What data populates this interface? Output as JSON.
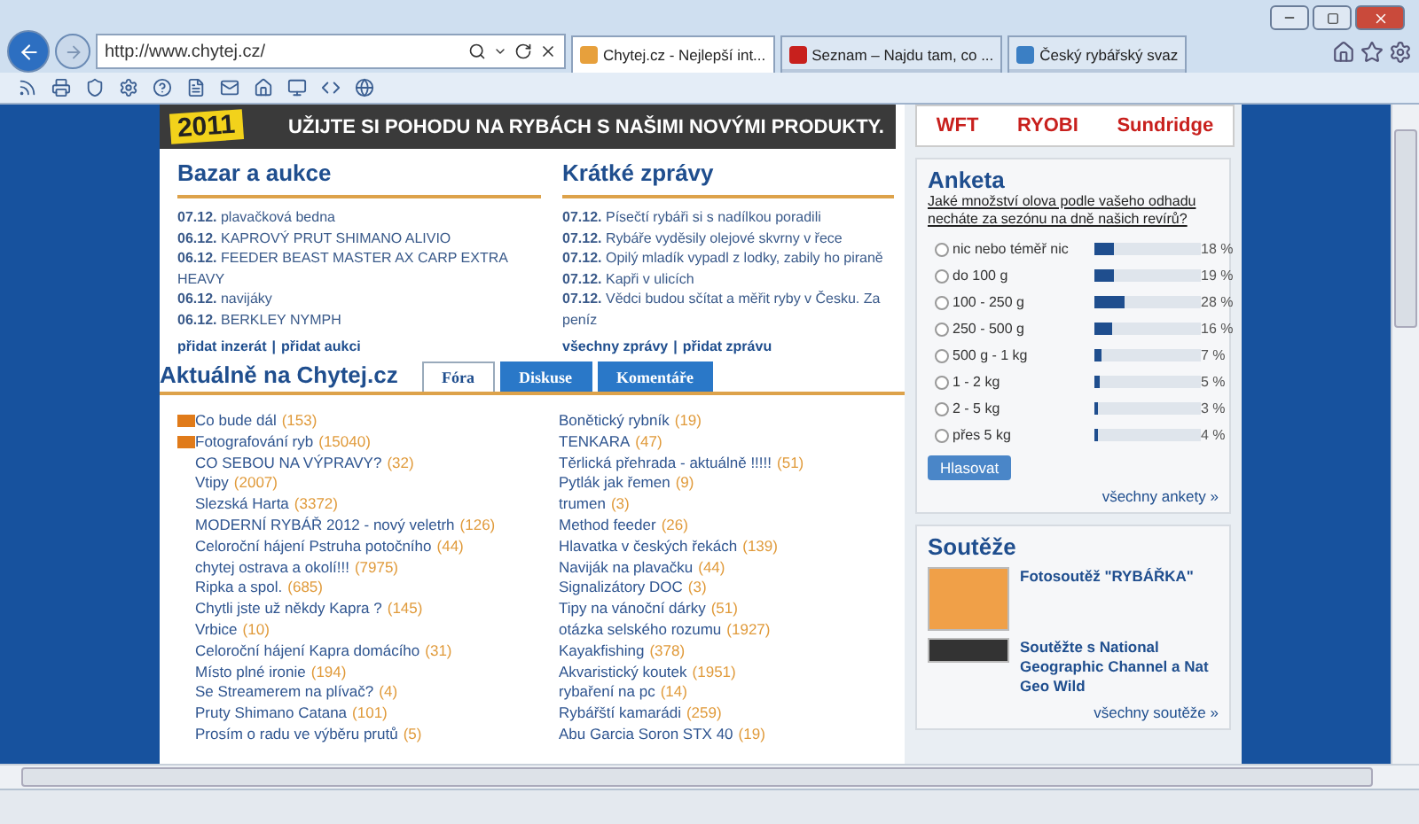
{
  "browser": {
    "address": "http://www.chytej.cz/",
    "tabs": [
      {
        "title": "Chytej.cz - Nejlepší int...",
        "selected": true,
        "kind": "fish"
      },
      {
        "title": "Seznam – Najdu tam, co ...",
        "selected": false,
        "kind": "brand"
      },
      {
        "title": "Český rybářský svaz",
        "selected": false,
        "kind": "globe"
      }
    ]
  },
  "banner": {
    "badge": "2011",
    "slogan": "UŽIJTE SI POHODU NA RYBÁCH S NAŠIMI NOVÝMI PRODUKTY.",
    "sponsors": [
      "WFT",
      "RYOBI",
      "Sundridge"
    ]
  },
  "bazar": {
    "title": "Bazar a aukce",
    "items": [
      {
        "date": "07.12.",
        "text": "plavačková bedna"
      },
      {
        "date": "06.12.",
        "text": "KAPROVÝ PRUT SHIMANO ALIVIO"
      },
      {
        "date": "06.12.",
        "text": "FEEDER BEAST MASTER AX CARP EXTRA HEAVY"
      },
      {
        "date": "06.12.",
        "text": "navijáky"
      },
      {
        "date": "06.12.",
        "text": "BERKLEY NYMPH"
      }
    ],
    "links": [
      "přidat inzerát",
      "přidat aukci"
    ],
    "separator": "|"
  },
  "news": {
    "title": "Krátké zprávy",
    "items": [
      {
        "date": "07.12.",
        "text": "Písečtí rybáři si s nadílkou poradili"
      },
      {
        "date": "07.12.",
        "text": "Rybáře vyděsily olejové skvrny v řece"
      },
      {
        "date": "07.12.",
        "text": "Opilý mladík vypadl z lodky, zabily ho piraně"
      },
      {
        "date": "07.12.",
        "text": "Kapři v ulicích"
      },
      {
        "date": "07.12.",
        "text": "Vědci budou sčítat a měřit ryby v Česku. Za peníz"
      }
    ],
    "links": [
      "všechny zprávy",
      "přidat zprávu"
    ],
    "separator": "|"
  },
  "current": {
    "title": "Aktuálně na Chytej.cz",
    "tabs": [
      {
        "label": "Fóra",
        "selected": true
      },
      {
        "label": "Diskuse",
        "selected": false
      },
      {
        "label": "Komentáře",
        "selected": false
      }
    ],
    "forums_left": [
      {
        "name": "Co bude dál",
        "count": "(153)",
        "new": true
      },
      {
        "name": "Fotografování ryb",
        "count": "(15040)",
        "new": true
      },
      {
        "name": "CO SEBOU NA VÝPRAVY?",
        "count": "(32)",
        "new": false
      },
      {
        "name": "Vtipy",
        "count": "(2007)",
        "new": false
      },
      {
        "name": "Slezská Harta",
        "count": "(3372)",
        "new": false
      },
      {
        "name": "MODERNÍ RYBÁŘ 2012 - nový veletrh",
        "count": "(126)",
        "new": false
      },
      {
        "name": "Celoroční hájení Pstruha potočního",
        "count": "(44)",
        "new": false
      },
      {
        "name": "chytej ostrava a okolí!!!",
        "count": "(7975)",
        "new": false
      },
      {
        "name": "Ripka a spol.",
        "count": "(685)",
        "new": false
      },
      {
        "name": "Chytli jste už někdy Kapra ?",
        "count": "(145)",
        "new": false
      },
      {
        "name": "Vrbice",
        "count": "(10)",
        "new": false
      },
      {
        "name": "Celoroční hájení Kapra domácího",
        "count": "(31)",
        "new": false
      },
      {
        "name": "Místo plné ironie",
        "count": "(194)",
        "new": false
      },
      {
        "name": "Se Streamerem na plívač?",
        "count": "(4)",
        "new": false
      },
      {
        "name": "Pruty Shimano Catana",
        "count": "(101)",
        "new": false
      },
      {
        "name": "Prosím o radu ve výběru prutů",
        "count": "(5)",
        "new": false
      }
    ],
    "forums_right": [
      {
        "name": "Bonětický rybník",
        "count": "(19)",
        "new": false
      },
      {
        "name": "TENKARA",
        "count": "(47)",
        "new": false
      },
      {
        "name": "Těrlická přehrada - aktuálně !!!!!",
        "count": "(51)",
        "new": false
      },
      {
        "name": "Pytlák jak řemen",
        "count": "(9)",
        "new": false
      },
      {
        "name": "trumen",
        "count": "(3)",
        "new": false
      },
      {
        "name": "Method feeder",
        "count": "(26)",
        "new": false
      },
      {
        "name": "Hlavatka v českých řekách",
        "count": "(139)",
        "new": false
      },
      {
        "name": "Naviják na plavačku",
        "count": "(44)",
        "new": false
      },
      {
        "name": "Signalizátory DOC",
        "count": "(3)",
        "new": false
      },
      {
        "name": "Tipy na vánoční dárky",
        "count": "(51)",
        "new": false
      },
      {
        "name": "otázka selského rozumu",
        "count": "(1927)",
        "new": false
      },
      {
        "name": "Kayakfishing",
        "count": "(378)",
        "new": false
      },
      {
        "name": "Akvaristický koutek",
        "count": "(1951)",
        "new": false
      },
      {
        "name": "rybaření na pc",
        "count": "(14)",
        "new": false
      },
      {
        "name": "Rybářští kamarádi",
        "count": "(259)",
        "new": false
      },
      {
        "name": "Abu Garcia Soron STX 40",
        "count": "(19)",
        "new": false
      }
    ]
  },
  "poll": {
    "title": "Anketa",
    "question": "Jaké množství olova podle vašeho odhadu necháte za sezónu na dně našich revírů?",
    "options": [
      {
        "label": "nic nebo téměř nic",
        "level": 0.18,
        "percent": "18 %",
        "selected": false
      },
      {
        "label": "do 100 g",
        "level": 0.19,
        "percent": "19 %",
        "selected": false
      },
      {
        "label": "100 - 250 g",
        "level": 0.28,
        "percent": "28 %",
        "selected": false
      },
      {
        "label": "250 - 500 g",
        "level": 0.16,
        "percent": "16 %",
        "selected": false
      },
      {
        "label": "500 g - 1 kg",
        "level": 0.07,
        "percent": "7 %",
        "selected": false
      },
      {
        "label": "1 - 2 kg",
        "level": 0.05,
        "percent": "5 %",
        "selected": false
      },
      {
        "label": "2 - 5 kg",
        "level": 0.03,
        "percent": "3 %",
        "selected": false
      },
      {
        "label": "přes 5 kg",
        "level": 0.04,
        "percent": "4 %",
        "selected": false
      }
    ],
    "button": "Hlasovat",
    "more": "všechny ankety »"
  },
  "contests": {
    "title": "Soutěže",
    "items": [
      {
        "title": "Fotosoutěž \"RYBÁŘKA\"",
        "kind": "square"
      },
      {
        "title": "Soutěžte s National Geographic Channel a Nat Geo Wild",
        "kind": "wide"
      }
    ],
    "more": "všechny soutěže »"
  }
}
